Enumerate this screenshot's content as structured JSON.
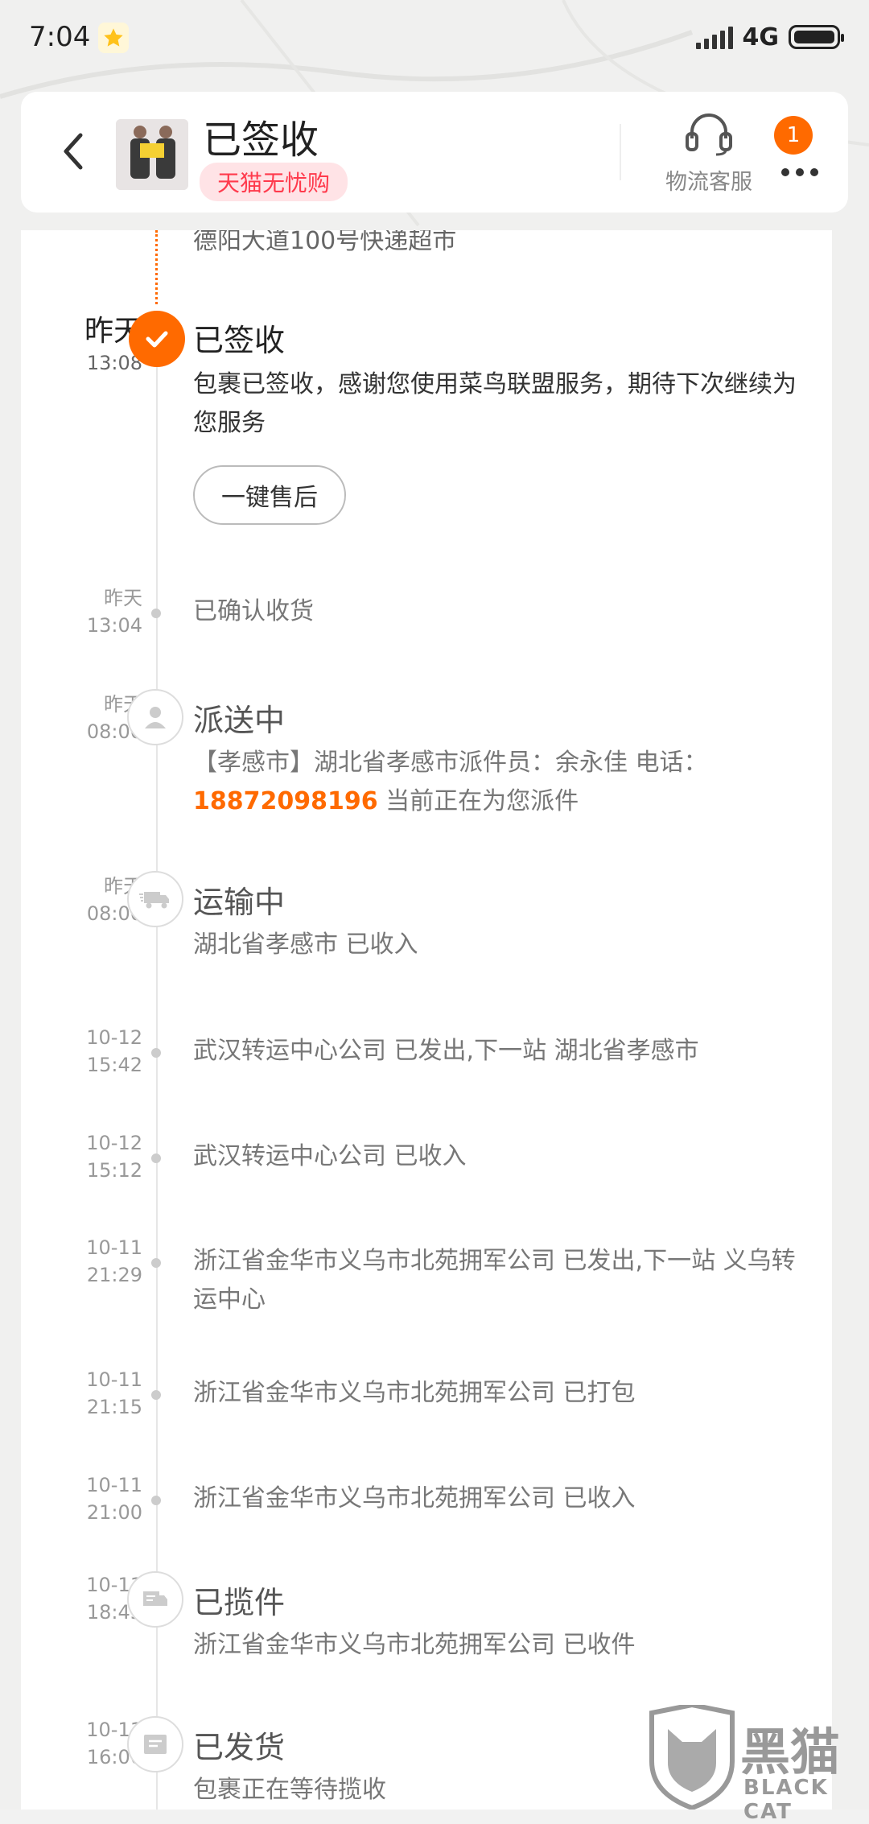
{
  "status_bar": {
    "time": "7:04",
    "network": "4G"
  },
  "header": {
    "title": "已签收",
    "tag": "天猫无忧购",
    "customer_service_label": "物流客服",
    "more_badge_count": "1"
  },
  "clipped_text": "德阳大道100号快递超市",
  "events": [
    {
      "date": "昨天",
      "time": "13:08",
      "title": "已签收",
      "desc": "包裹已签收，感谢您使用菜鸟联盟服务，期待下次继续为您服务",
      "button": "一键售后"
    },
    {
      "date": "昨天",
      "time": "13:04",
      "desc": "已确认收货"
    },
    {
      "date": "昨天",
      "time": "08:00",
      "title": "派送中",
      "desc_prefix": "【孝感市】湖北省孝感市派件员：余永佳 电话：",
      "phone": "18872098196",
      "desc_suffix": " 当前正在为您派件"
    },
    {
      "date": "昨天",
      "time": "08:00",
      "title": "运输中",
      "desc": "湖北省孝感市 已收入"
    },
    {
      "date": "10-12",
      "time": "15:42",
      "desc": "武汉转运中心公司 已发出,下一站 湖北省孝感市"
    },
    {
      "date": "10-12",
      "time": "15:12",
      "desc": "武汉转运中心公司 已收入"
    },
    {
      "date": "10-11",
      "time": "21:29",
      "desc": "浙江省金华市义乌市北苑拥军公司 已发出,下一站 义乌转运中心"
    },
    {
      "date": "10-11",
      "time": "21:15",
      "desc": "浙江省金华市义乌市北苑拥军公司 已打包"
    },
    {
      "date": "10-11",
      "time": "21:00",
      "desc": "浙江省金华市义乌市北苑拥军公司 已收入"
    },
    {
      "date": "10-11",
      "time": "18:45",
      "title": "已揽件",
      "desc": "浙江省金华市义乌市北苑拥军公司 已收件"
    },
    {
      "date": "10-11",
      "time": "16:06",
      "title": "已发货",
      "desc": "包裹正在等待揽收"
    }
  ],
  "watermark": {
    "text": "黑猫",
    "sub": "BLACK CAT"
  },
  "colors": {
    "accent": "#ff6a00",
    "tag_bg": "#ffe3e6",
    "tag_text": "#ff3a4c"
  }
}
